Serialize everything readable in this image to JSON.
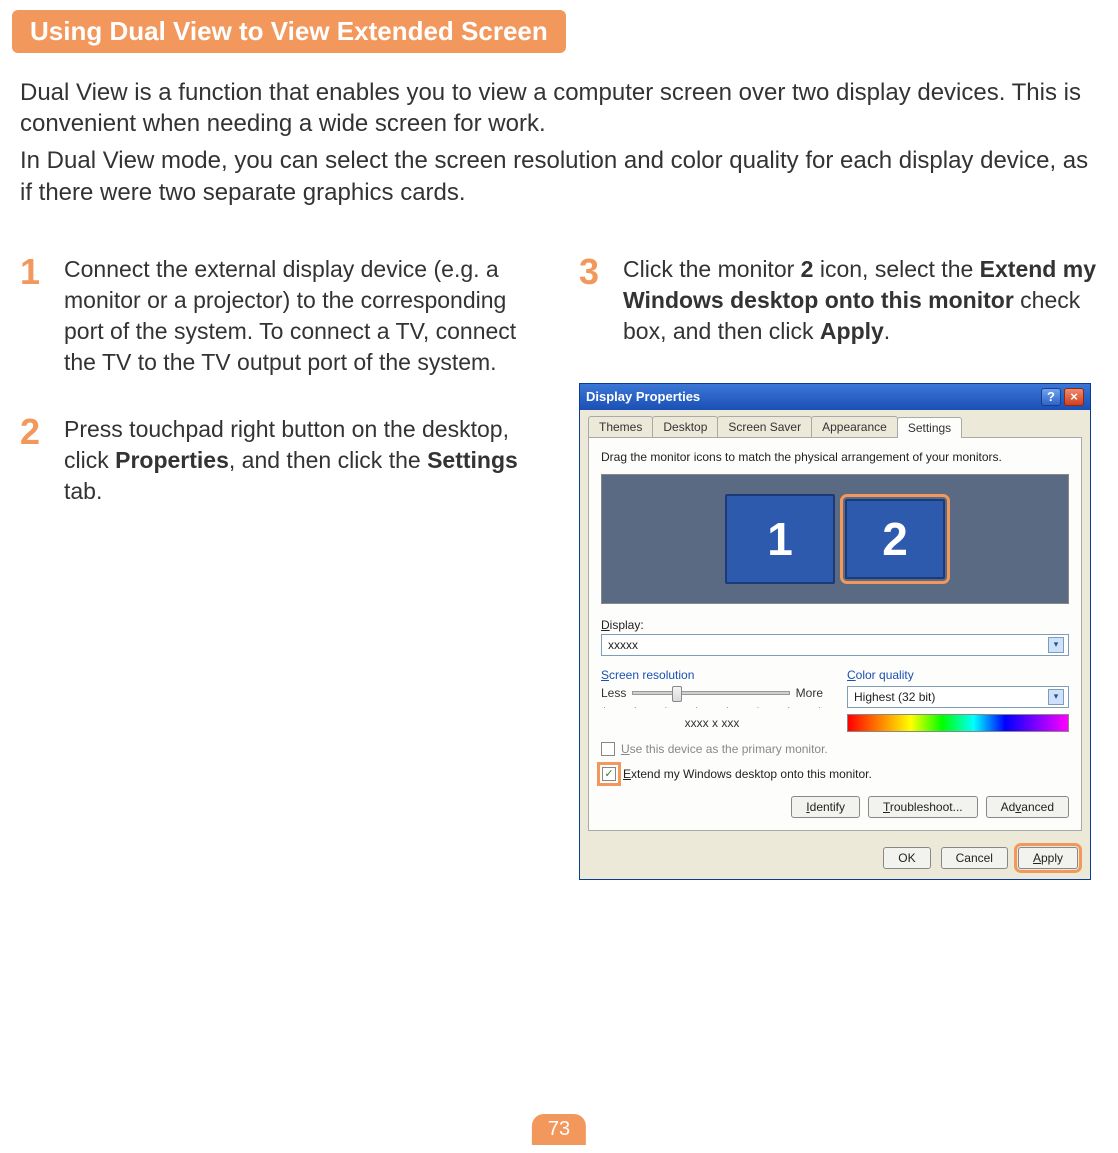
{
  "header": {
    "title": "Using Dual View to View Extended Screen"
  },
  "intro": {
    "p1": "Dual View is a function that enables you to view a computer screen over two display devices. This is convenient when needing a wide screen for work.",
    "p2": "In Dual View mode, you can select the screen resolution and color quality for each display device, as if there were two separate graphics cards."
  },
  "steps": {
    "s1": {
      "num": "1",
      "text": "Connect the external display device (e.g. a monitor or a projector) to the corresponding port of the system. To connect a TV, connect the TV to the TV output port of the system."
    },
    "s2": {
      "num": "2",
      "pre": "Press touchpad right button on the desktop, click ",
      "b1": "Properties",
      "mid": ", and then click the ",
      "b2": "Settings",
      "post": " tab."
    },
    "s3": {
      "num": "3",
      "pre": "Click the monitor ",
      "b1": "2",
      "mid1": " icon, select the ",
      "b2": "Extend my Windows desktop onto this monitor",
      "mid2": " check box, and then click ",
      "b3": "Apply",
      "post": "."
    }
  },
  "dialog": {
    "title": "Display Properties",
    "tabs": {
      "themes": "Themes",
      "desktop": "Desktop",
      "screensaver": "Screen Saver",
      "appearance": "Appearance",
      "settings": "Settings"
    },
    "drag_text": "Drag the monitor icons to match the physical arrangement of your monitors.",
    "monitors": {
      "m1": "1",
      "m2": "2"
    },
    "display_label": "Display:",
    "display_value": "xxxxx",
    "resolution_label": "Screen resolution",
    "less": "Less",
    "more": "More",
    "res_value": "xxxx  x  xxx",
    "color_label": "Color quality",
    "color_value": "Highest (32 bit)",
    "check_primary": "Use this device as the primary monitor.",
    "check_extend": "Extend my Windows desktop onto this monitor.",
    "buttons": {
      "identify": "Identify",
      "troubleshoot": "Troubleshoot...",
      "advanced": "Advanced",
      "ok": "OK",
      "cancel": "Cancel",
      "apply": "Apply"
    }
  },
  "page_number": "73"
}
